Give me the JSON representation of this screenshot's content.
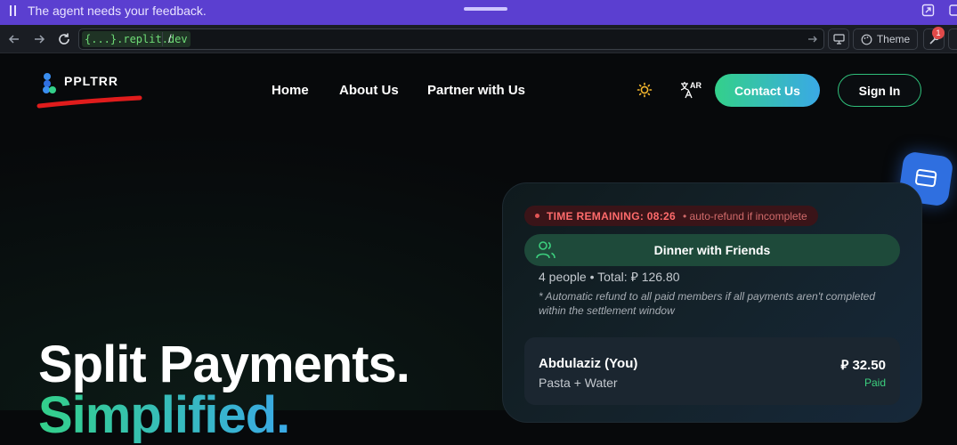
{
  "feedback_bar": {
    "message": "The agent needs your feedback."
  },
  "browser": {
    "url_host": "{...}.replit.dev",
    "url_path": "/",
    "theme_label": "Theme",
    "dev_badge_count": "1"
  },
  "header": {
    "logo_text": "PPLTRR",
    "nav": {
      "home": "Home",
      "about": "About Us",
      "partner": "Partner with Us"
    },
    "lang_label": "AR",
    "contact_label": "Contact Us",
    "signin_label": "Sign In"
  },
  "hero": {
    "title": "Split Payments.",
    "subtitle": "Simplified."
  },
  "card": {
    "timer_label": "TIME REMAINING: 08:26",
    "timer_note": "• auto-refund if incomplete",
    "group_name": "Dinner with Friends",
    "meta": "4 people • Total: ⃁ 126.80",
    "refund_note": "* Automatic refund to all paid members if all payments aren't completed within the settlement window",
    "member": {
      "name": "Abdulaziz (You)",
      "items": "Pasta + Water",
      "amount": "⃁ 32.50",
      "status": "Paid"
    }
  },
  "colors": {
    "accent_purple": "#5b3fd0",
    "brand_green": "#33d08a",
    "brand_blue": "#3aa9e6",
    "danger": "#ff6b6b",
    "paid_green": "#3ccf7e"
  }
}
